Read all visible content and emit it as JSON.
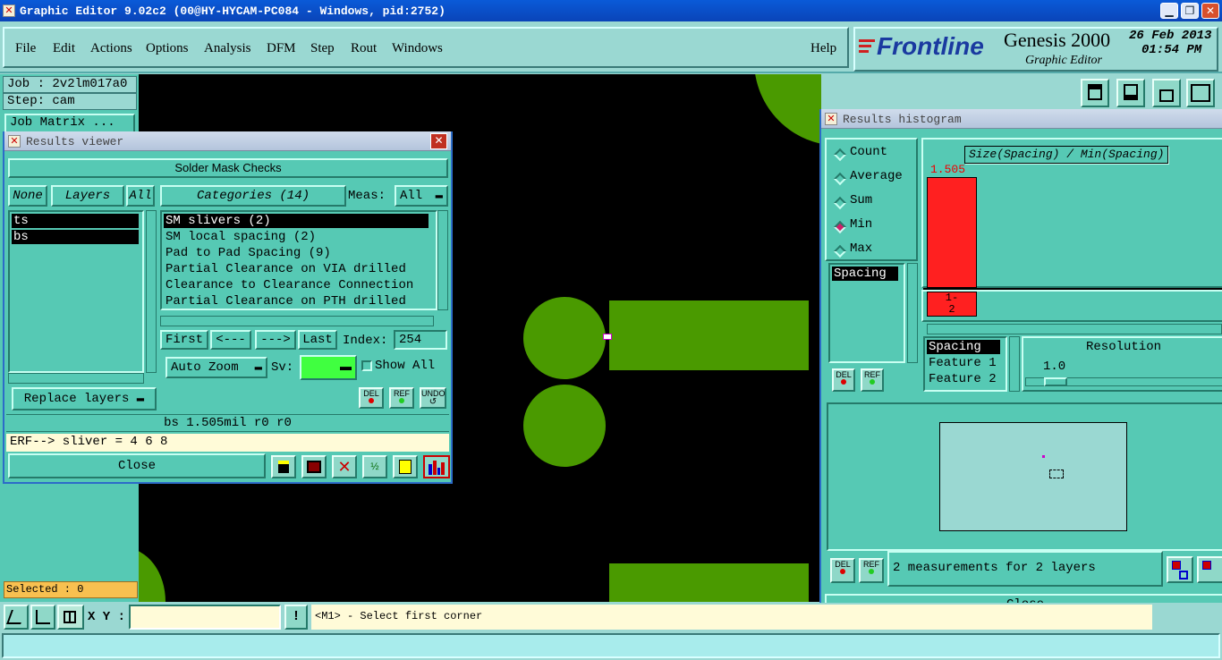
{
  "app_title": "Graphic Editor 9.02c2 (00@HY-HYCAM-PC084 - Windows, pid:2752)",
  "menu": {
    "file": "File",
    "edit": "Edit",
    "actions": "Actions",
    "options": "Options",
    "analysis": "Analysis",
    "dfm": "DFM",
    "step": "Step",
    "rout": "Rout",
    "windows": "Windows",
    "help": "Help"
  },
  "brand": {
    "logo": "Frontline",
    "product": "Genesis 2000",
    "subtitle": "Graphic Editor",
    "date": "26 Feb 2013",
    "time": "01:54 PM"
  },
  "left_panel": {
    "job": "Job : 2v2lm017a0",
    "step": "Step: cam",
    "job_matrix": "Job Matrix ...",
    "selected": "Selected : 0"
  },
  "results_viewer": {
    "title": "Results viewer",
    "header": "Solder Mask Checks",
    "none_btn": "None",
    "layers_btn": "Layers",
    "all_btn": "All",
    "layers": [
      "ts",
      "bs"
    ],
    "categories_btn": "Categories (14)",
    "meas_label": "Meas:",
    "meas_value": "All",
    "categories": [
      "SM slivers (2)",
      "SM local spacing (2)",
      "Pad to Pad Spacing (9)",
      "Partial Clearance on VIA drilled",
      "Clearance to Clearance Connection",
      "Partial Clearance on PTH drilled"
    ],
    "first": "First",
    "prev": "<---",
    "next": "--->",
    "last": "Last",
    "index_label": "Index:",
    "index_value": "254",
    "auto_zoom": "Auto Zoom",
    "sv_label": "Sv:",
    "show_all": "Show All",
    "replace_layers": "Replace layers",
    "del": "DEL",
    "ref": "REF",
    "undo": "UNDO",
    "info": "bs 1.505mil  r0  r0",
    "erf": "ERF--> sliver = 4 6 8",
    "close": "Close"
  },
  "histogram": {
    "title": "Results histogram",
    "radios": [
      "Count",
      "Average",
      "Sum",
      "Min",
      "Max"
    ],
    "selected_radio": "Min",
    "measure_list": [
      "Spacing"
    ],
    "chart_title": "Size(Spacing) / Min(Spacing)",
    "bar_value": "1.505",
    "bar_label": "1-\n2",
    "field_list": [
      "Spacing",
      "Feature 1",
      "Feature 2"
    ],
    "resolution_label": "Resolution",
    "resolution_value": "1.0",
    "del": "DEL",
    "ref": "REF",
    "summary": "2 measurements for 2 layers",
    "close": "Close"
  },
  "bottom": {
    "xy_label": "X Y :",
    "xy_value": "",
    "prompt": "<M1> - Select first corner"
  },
  "colors": {
    "panel": "#56c9b4",
    "copper": "#4a9a00",
    "bar": "#ff2020",
    "title_blue": "#0a44b8"
  }
}
